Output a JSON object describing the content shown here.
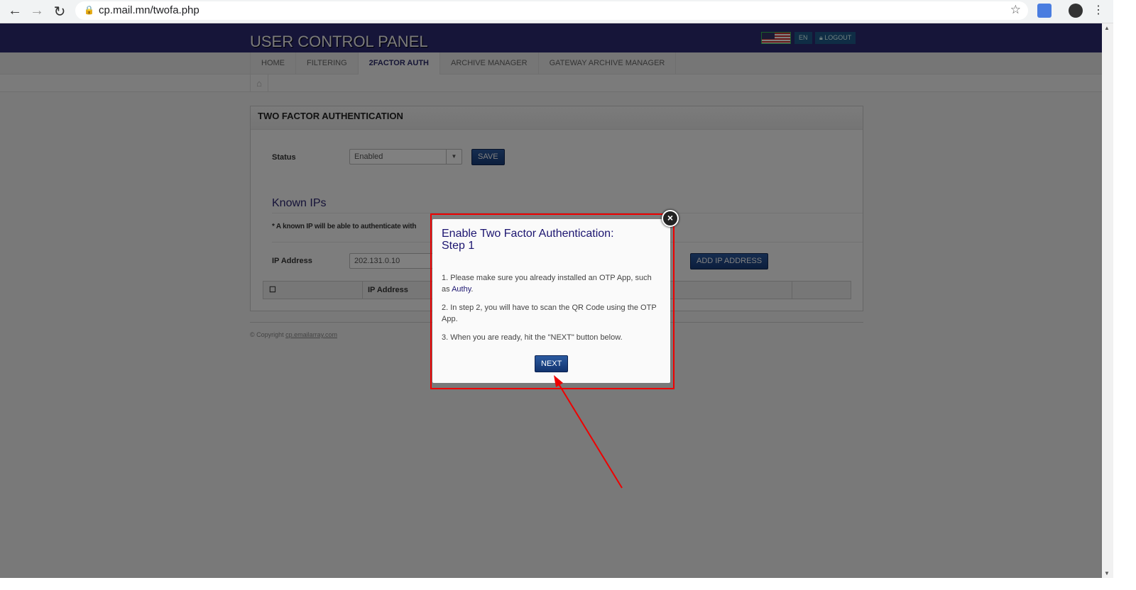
{
  "browser": {
    "url": "cp.mail.mn/twofa.php"
  },
  "header": {
    "title": "USER CONTROL PANEL",
    "lang": "EN",
    "logout": "LOGOUT"
  },
  "nav": {
    "items": [
      "HOME",
      "FILTERING",
      "2FACTOR AUTH",
      "ARCHIVE MANAGER",
      "GATEWAY ARCHIVE MANAGER"
    ],
    "active": "2FACTOR AUTH"
  },
  "panel": {
    "title": "TWO FACTOR AUTHENTICATION",
    "status_label": "Status",
    "status_value": "Enabled",
    "save": "SAVE",
    "known_title": "Known IPs",
    "known_note": "* A known IP will be able to authenticate with",
    "ip_label": "IP Address",
    "ip_value": "202.131.0.10",
    "add_ip": "ADD IP ADDRESS",
    "col_ip": "IP Address"
  },
  "footer": {
    "copyright": "© Copyright",
    "link": "cp.emailarray.com"
  },
  "modal": {
    "title_line1": "Enable Two Factor Authentication:",
    "title_line2": "Step 1",
    "step1": "1. Please make sure you already installed an OTP App, such as",
    "step1_link": "Authy",
    "step2": "2. In step 2, you will have to scan the QR Code using the OTP App.",
    "step3": "3. When you are ready, hit the \"NEXT\" button below.",
    "next": "NEXT",
    "close": "×"
  },
  "colors": {
    "annotation": "#e00000",
    "header": "#2c2a72",
    "button": "#1f4a8c"
  }
}
